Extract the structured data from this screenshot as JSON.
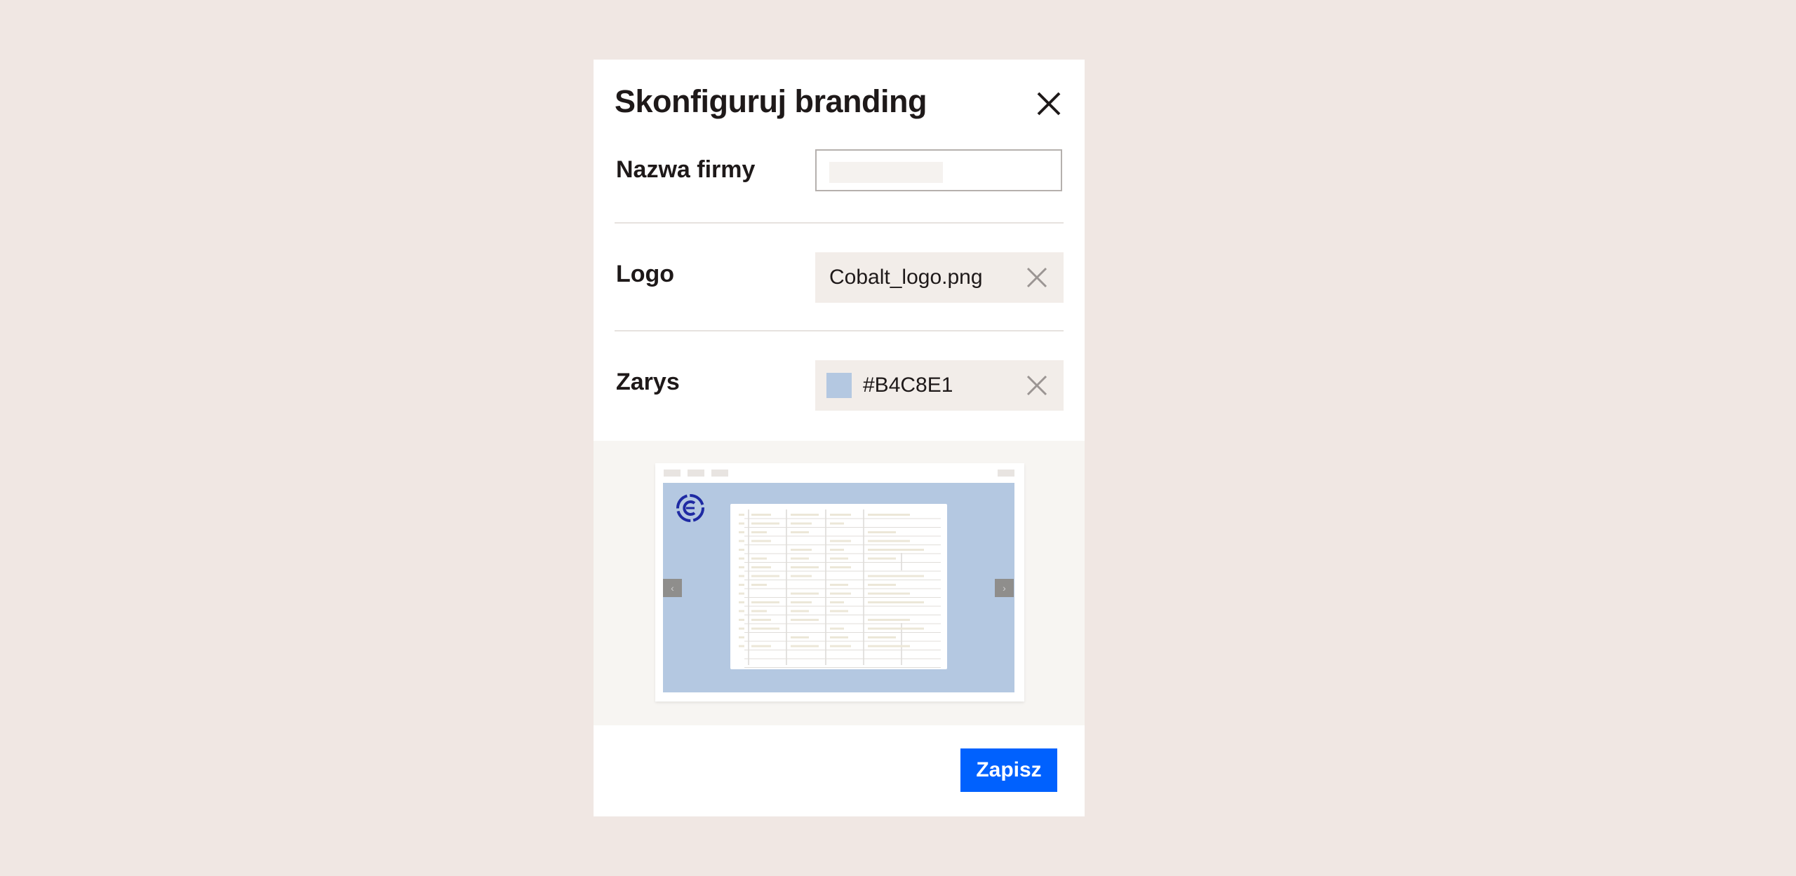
{
  "dialog": {
    "title": "Skonfiguruj branding",
    "close_icon": "close-icon"
  },
  "fields": {
    "company_name": {
      "label": "Nazwa firmy",
      "value": ""
    },
    "logo": {
      "label": "Logo",
      "file_name": "Cobalt_logo.png",
      "clear_icon": "close-icon"
    },
    "outline": {
      "label": "Zarys",
      "color_value": "#B4C8E1",
      "clear_icon": "close-icon"
    }
  },
  "preview": {
    "brand_color": "#B4C8E1",
    "logo_color": "#1e2aa3",
    "prev_icon": "chevron-left-icon",
    "next_icon": "chevron-right-icon",
    "prev_glyph": "‹",
    "next_glyph": "›"
  },
  "footer": {
    "save_label": "Zapisz"
  },
  "colors": {
    "page_background": "#f0e7e3",
    "accent": "#0061fe"
  }
}
